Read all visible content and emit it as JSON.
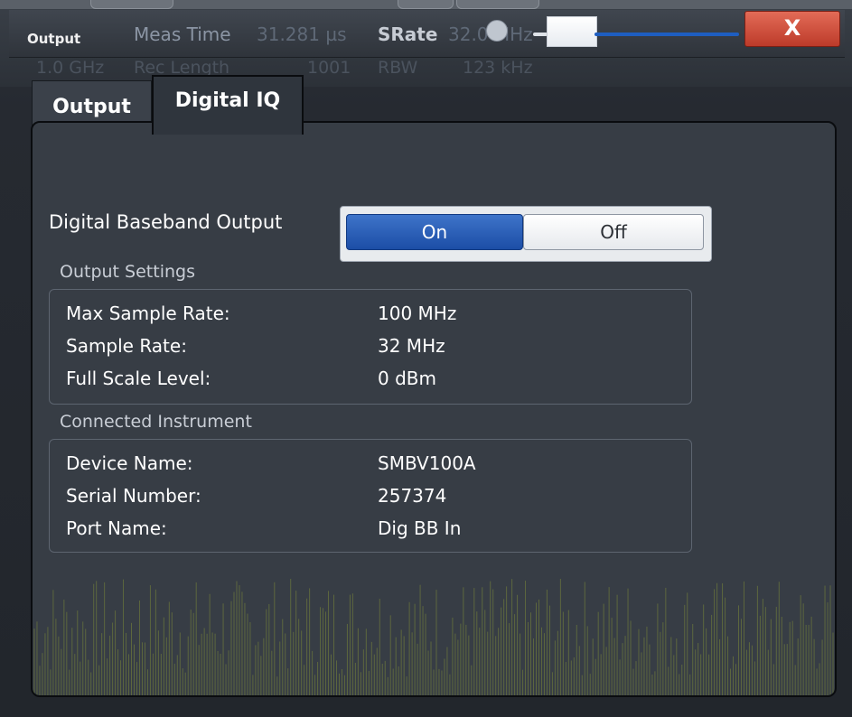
{
  "window": {
    "title": "Output",
    "close_symbol": "X"
  },
  "background_status": {
    "meas_time_label": "Meas Time",
    "meas_time_value": "31.281 µs",
    "srate_label": "SRate",
    "srate_value": "32.0 MHz",
    "row2": [
      "1.0 GHz",
      "Rec Length",
      "1001",
      "RBW",
      "123 kHz"
    ]
  },
  "tabs": [
    {
      "label": "Output",
      "active": false
    },
    {
      "label": "Digital IQ",
      "active": true
    }
  ],
  "digital_baseband": {
    "label": "Digital Baseband Output",
    "on_label": "On",
    "off_label": "Off",
    "selected": "On"
  },
  "output_settings": {
    "title": "Output Settings",
    "rows": [
      {
        "label": "Max Sample Rate:",
        "value": "100 MHz"
      },
      {
        "label": "Sample Rate:",
        "value": "32 MHz"
      },
      {
        "label": "Full Scale Level:",
        "value": "0 dBm"
      }
    ]
  },
  "connected_instrument": {
    "title": "Connected Instrument",
    "rows": [
      {
        "label": "Device Name:",
        "value": "SMBV100A"
      },
      {
        "label": "Serial Number:",
        "value": "257374"
      },
      {
        "label": "Port Name:",
        "value": "Dig BB In"
      }
    ]
  },
  "colors": {
    "accent_blue": "#1c4ea6",
    "close_red": "#d0503e",
    "panel_bg": "#373d45",
    "trace": "#7c8a3a"
  }
}
